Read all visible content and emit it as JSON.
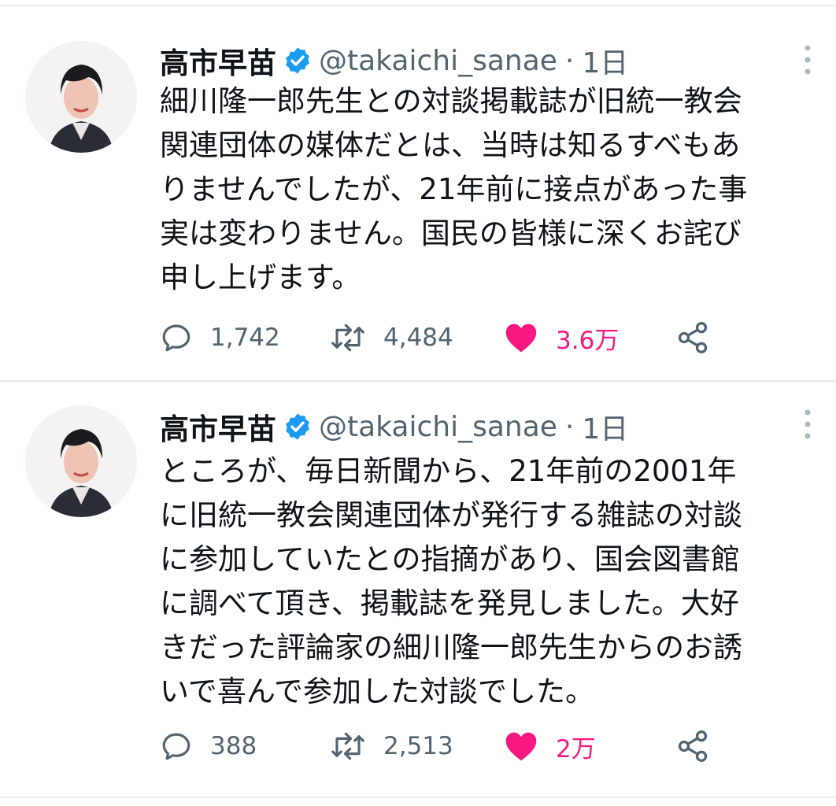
{
  "tweets": [
    {
      "name": "高市早苗",
      "handle": "@takaichi_sanae",
      "separator": "·",
      "time": "1日",
      "text": "細川隆一郎先生との対談掲載誌が旧統一教会\n関連団体の媒体だとは、当時は知るすべもあ\nりませんでしたが、21年前に接点があった事\n実は変わりません。国民の皆様に深くお詫び\n申し上げます。",
      "replies": "1,742",
      "retweets": "4,484",
      "likes": "3.6万",
      "liked": true
    },
    {
      "name": "高市早苗",
      "handle": "@takaichi_sanae",
      "separator": "·",
      "time": "1日",
      "text": "ところが、毎日新聞から、21年前の2001年\nに旧統一教会関連団体が発行する雑誌の対談\nに参加していたとの指摘があり、国会図書館\nに調べて頂き、掲載誌を発見しました。大好\nきだった評論家の細川隆一郎先生からのお誘\nいで喜んで参加した対談でした。",
      "replies": "388",
      "retweets": "2,513",
      "likes": "2万",
      "liked": true
    }
  ],
  "colors": {
    "text": "#0f1419",
    "muted": "#536471",
    "like": "#f91880",
    "verified": "#1d9bf0",
    "divider": "#e8ebee"
  },
  "icons": [
    "reply-icon",
    "retweet-icon",
    "like-icon",
    "share-icon",
    "more-icon",
    "verified-badge-icon"
  ]
}
